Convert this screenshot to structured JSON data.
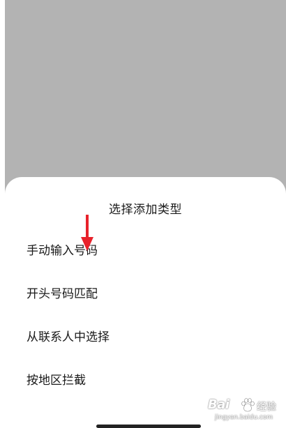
{
  "sheet": {
    "title": "选择添加类型",
    "options": [
      {
        "label": "手动输入号码"
      },
      {
        "label": "开头号码匹配"
      },
      {
        "label": "从联系人中选择"
      },
      {
        "label": "按地区拦截"
      }
    ]
  },
  "watermark": {
    "brand": "Bai",
    "suffix": "经验",
    "url": "jingyan.baidu.com"
  },
  "colors": {
    "scrim": "#b3b3b3",
    "sheet_bg": "#ffffff",
    "arrow": "#e8222b",
    "text": "#1a1a1a"
  }
}
